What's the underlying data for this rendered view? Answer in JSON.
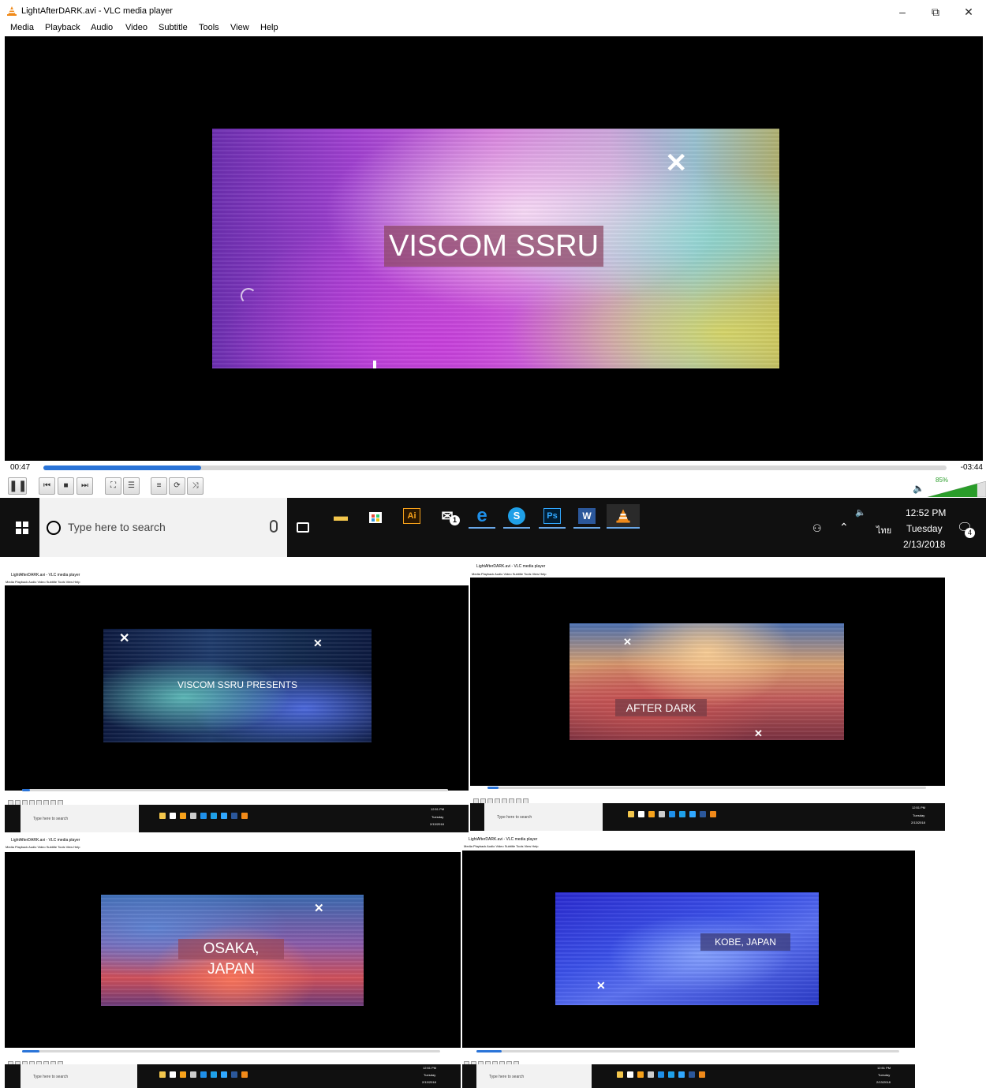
{
  "window": {
    "title": "LightAfterDARK.avi - VLC media player",
    "minimize": "–",
    "restore": "⧉",
    "close": "✕"
  },
  "menu": [
    "Media",
    "Playback",
    "Audio",
    "Video",
    "Subtitle",
    "Tools",
    "View",
    "Help"
  ],
  "player": {
    "caption": "VISCOM SSRU",
    "elapsed": "00:47",
    "remaining": "-03:44",
    "progress": 0.175,
    "volume_percent": "85%",
    "volume": 0.85
  },
  "taskbar": {
    "search_placeholder": "Type here to search",
    "mail_badge": "1",
    "apps": [
      "file-explorer",
      "store",
      "illustrator",
      "mail",
      "edge",
      "skype",
      "photoshop",
      "word",
      "vlc"
    ],
    "illustrator_label": "Ai",
    "photoshop_label": "Ps",
    "word_label": "W",
    "language": "ไทย",
    "time": "12:52 PM",
    "day": "Tuesday",
    "date": "2/13/2018",
    "notification_count": "4"
  },
  "thumbnails": [
    {
      "caption": "VISCOM SSRU PRESENTS",
      "time_small": "12:51 PM",
      "day_small": "Tuesday",
      "date_small": "2/13/2018",
      "search_small": "Type here to search"
    },
    {
      "caption": "AFTER DARK",
      "time_small": "12:51 PM",
      "day_small": "Tuesday",
      "date_small": "2/13/2018",
      "search_small": "Type here to search"
    },
    {
      "caption": "OSAKA, JAPAN",
      "time_small": "12:51 PM",
      "day_small": "Tuesday",
      "date_small": "2/13/2018",
      "search_small": "Type here to search"
    },
    {
      "caption": "KOBE, JAPAN",
      "time_small": "12:51 PM",
      "day_small": "Tuesday",
      "date_small": "2/13/2018",
      "search_small": "Type here to search"
    }
  ],
  "colors": {
    "accent_blue": "#2a74d8",
    "volume_green": "#2a9d2a",
    "taskbar_bg": "#101010"
  }
}
